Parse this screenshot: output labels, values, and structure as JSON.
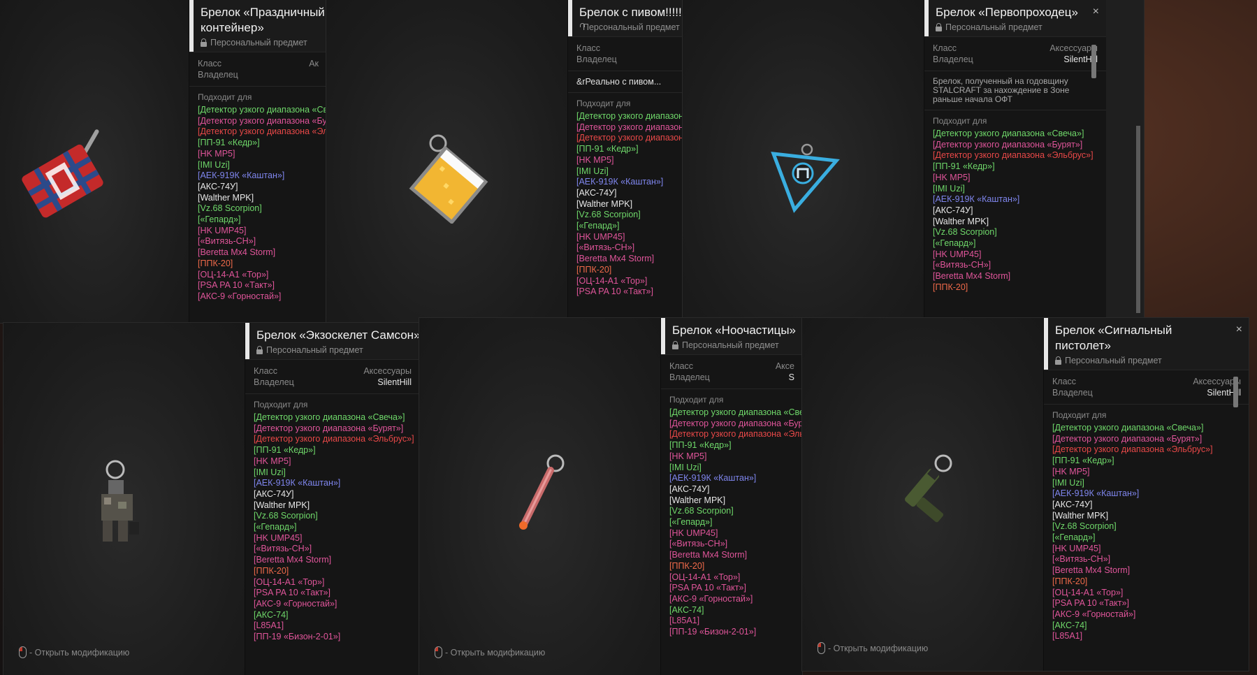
{
  "hint_text": "- Открыть модификацию",
  "labels": {
    "class": "Класс",
    "owner": "Владелец",
    "fits": "Подходит для",
    "personal": "Персональный предмет"
  },
  "colors": {
    "green": "#6fd86a",
    "pink": "#e0559a",
    "red": "#e84848",
    "blue": "#7f86ee",
    "white": "#e8e8e8",
    "orange": "#f06a4a",
    "violet": "#b56ad8"
  },
  "fits_list": [
    {
      "text": "[Детектор узкого диапазона «Свеча»]",
      "color": "green"
    },
    {
      "text": "[Детектор узкого диапазона «Бурят»]",
      "color": "pink"
    },
    {
      "text": "[Детектор узкого диапазона «Эльбрус»]",
      "color": "red"
    },
    {
      "text": "[ПП-91 «Кедр»]",
      "color": "green"
    },
    {
      "text": "[HK MP5]",
      "color": "pink"
    },
    {
      "text": "[IMI Uzi]",
      "color": "green"
    },
    {
      "text": "[АЕК-919К «Каштан»]",
      "color": "blue"
    },
    {
      "text": "[АКС-74У]",
      "color": "white"
    },
    {
      "text": "[Walther MPK]",
      "color": "white"
    },
    {
      "text": "[Vz.68 Scorpion]",
      "color": "green"
    },
    {
      "text": "[«Гепард»]",
      "color": "green"
    },
    {
      "text": "[HK UMP45]",
      "color": "pink"
    },
    {
      "text": "[«Витязь-СН»]",
      "color": "pink"
    },
    {
      "text": "[Beretta Mx4 Storm]",
      "color": "pink"
    },
    {
      "text": "[ППК-20]",
      "color": "orange"
    },
    {
      "text": "[ОЦ-14-А1 «Тор»]",
      "color": "pink"
    },
    {
      "text": "[PSA PA 10 «Такт»]",
      "color": "pink"
    },
    {
      "text": "[АКС-9 «Горностай»]",
      "color": "pink"
    },
    {
      "text": "[АКС-74]",
      "color": "green"
    },
    {
      "text": "[L85A1]",
      "color": "pink"
    },
    {
      "text": "[ПП-19 «Бизон-2-01»]",
      "color": "pink"
    }
  ],
  "cards": [
    {
      "title": "Брелок «Праздничный контейнер»",
      "class_value": "Ак",
      "owner_value": ""
    },
    {
      "title": "Брелок с пивом!!!!!",
      "class_value": "",
      "owner_value": "",
      "note": "&rРеально с пивом..."
    },
    {
      "title": "Брелок «Первопроходец»",
      "class_value": "Аксессуары",
      "owner_value": "SilentHill",
      "description": "Брелок, полученный на годовщину STALCRAFT за нахождение в Зоне раньше начала ОФТ"
    },
    {
      "title": "Брелок «Экзоскелет Самсон»",
      "class_value": "Аксессуары",
      "owner_value": "SilentHill"
    },
    {
      "title": "Брелок «Ноочастицы»",
      "class_value": "Аксе",
      "owner_value": "S"
    },
    {
      "title": "Брелок «Сигнальный пистолет»",
      "class_value": "Аксессуары",
      "owner_value": "SilentHill"
    }
  ],
  "close_icon": "×"
}
